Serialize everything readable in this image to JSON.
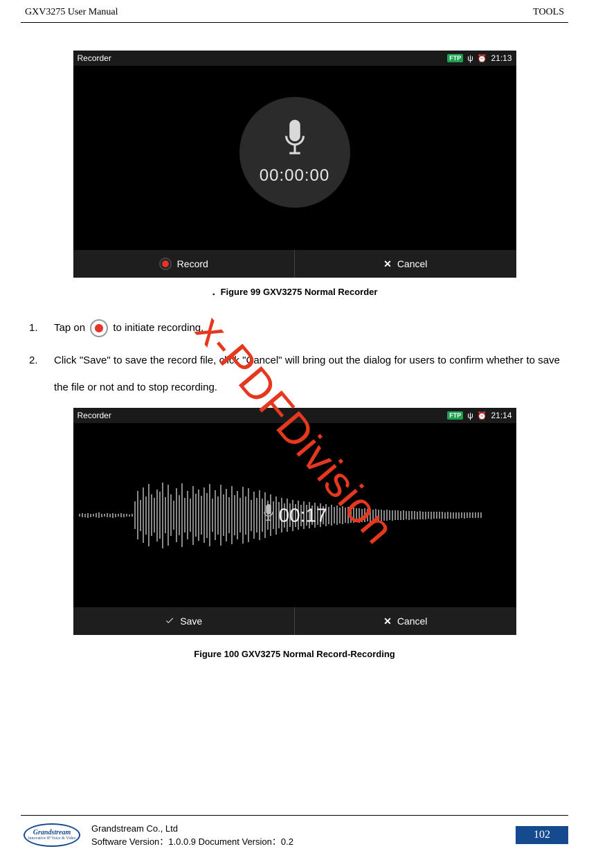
{
  "header": {
    "left": "GXV3275 User Manual",
    "right": "TOOLS"
  },
  "watermark": "x-PDFDivision",
  "shot1": {
    "title": "Recorder",
    "ftp": "FTP",
    "time": "21:13",
    "timer": "00:00:00",
    "record_label": "Record",
    "cancel_label": "Cancel"
  },
  "caption1": "．Figure 99 GXV3275 Normal Recorder",
  "step1": {
    "num": "1.",
    "before": "Tap on",
    "after": "to initiate recording."
  },
  "step2": {
    "num": "2.",
    "text": "Click \"Save\" to save the record file, click \"Cancel\" will bring out the dialog for users to confirm whether to save the file or not and to stop recording."
  },
  "shot2": {
    "title": "Recorder",
    "ftp": "FTP",
    "time": "21:14",
    "timer": "00:17",
    "save_label": "Save",
    "cancel_label": "Cancel"
  },
  "caption2": "Figure 100 GXV3275 Normal Record-Recording",
  "footer": {
    "logo_line1": "Grandstream",
    "logo_line2": "Innovative IP Voice & Video",
    "company": "Grandstream Co., Ltd",
    "version": "Software Version：1.0.0.9 Document Version：0.2",
    "page": "102"
  }
}
